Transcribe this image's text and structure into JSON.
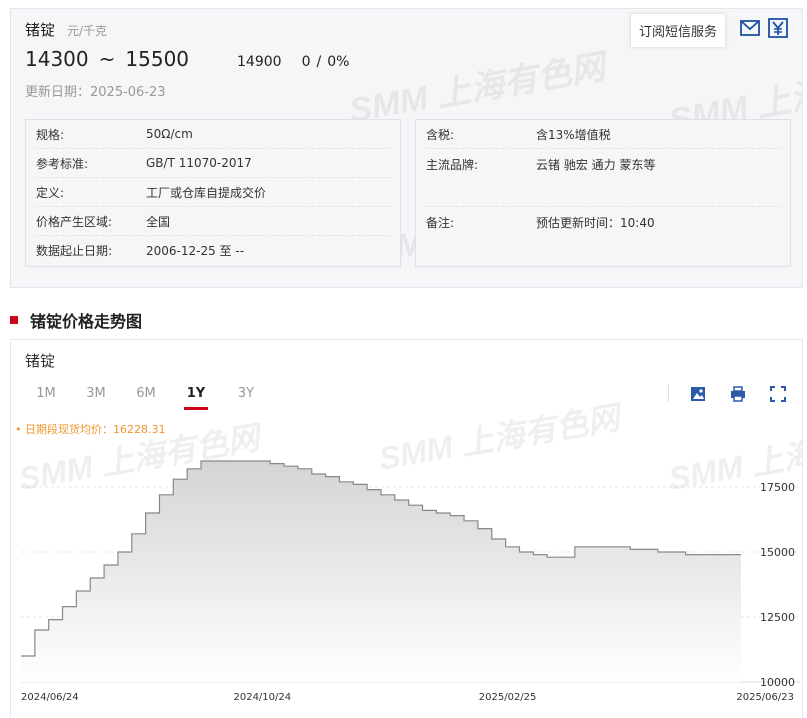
{
  "header": {
    "product": "锗锭",
    "unit": "元/千克",
    "price_low": "14300",
    "tilde": "~",
    "price_high": "15500",
    "avg": "14900",
    "change": "0",
    "change_sep": "/",
    "change_pct": "0%",
    "update_date": "更新日期：2025-06-23",
    "subscribe_label": "订阅短信服务",
    "watermark": "SMM 上海有色网",
    "icons": [
      "mail-icon",
      "yen-icon"
    ]
  },
  "info_left": [
    {
      "k": "规格:",
      "v": "50Ω/cm"
    },
    {
      "k": "参考标准:",
      "v": "GB/T 11070-2017"
    },
    {
      "k": "定义:",
      "v": "工厂或仓库自提成交价"
    },
    {
      "k": "价格产生区域:",
      "v": "全国"
    },
    {
      "k": "数据起止日期:",
      "v": "2006-12-25 至 --"
    }
  ],
  "info_right": [
    {
      "k": "含税:",
      "v": "含13%增值税"
    },
    {
      "k": "主流品牌:",
      "v": "云锗 驰宏 通力 蒙东等"
    },
    {
      "k": "备注:",
      "v": "预估更新时间：10:40"
    }
  ],
  "section": {
    "title": "锗锭价格走势图"
  },
  "chart_panel": {
    "title": "锗锭",
    "tabs": [
      "1M",
      "3M",
      "6M",
      "1Y",
      "3Y"
    ],
    "active_tab": "1Y",
    "legend": "• 日期段现货均价：16228.31",
    "tools": [
      "download-image-icon",
      "print-icon",
      "fullscreen-icon"
    ]
  },
  "colors": {
    "accent": "#d0021b",
    "legend": "#f0962d",
    "line": "#888888"
  },
  "chart_data": {
    "type": "area",
    "x": [
      "2024-06-24",
      "2024-07-01",
      "2024-07-08",
      "2024-07-15",
      "2024-07-22",
      "2024-07-29",
      "2024-08-05",
      "2024-08-12",
      "2024-08-19",
      "2024-08-26",
      "2024-09-02",
      "2024-09-09",
      "2024-09-16",
      "2024-09-23",
      "2024-09-30",
      "2024-10-07",
      "2024-10-14",
      "2024-10-21",
      "2024-10-28",
      "2024-11-04",
      "2024-11-11",
      "2024-11-18",
      "2024-11-25",
      "2024-12-02",
      "2024-12-09",
      "2024-12-16",
      "2024-12-23",
      "2024-12-30",
      "2025-01-06",
      "2025-01-13",
      "2025-01-20",
      "2025-01-27",
      "2025-02-03",
      "2025-02-10",
      "2025-02-17",
      "2025-02-24",
      "2025-03-03",
      "2025-03-10",
      "2025-03-17",
      "2025-03-24",
      "2025-03-31",
      "2025-04-07",
      "2025-04-14",
      "2025-04-21",
      "2025-04-28",
      "2025-05-05",
      "2025-05-12",
      "2025-05-19",
      "2025-05-26",
      "2025-06-02",
      "2025-06-09",
      "2025-06-16",
      "2025-06-23"
    ],
    "y": [
      11000,
      12000,
      12400,
      12900,
      13500,
      14000,
      14500,
      15000,
      15700,
      16500,
      17200,
      17800,
      18200,
      18500,
      18500,
      18500,
      18500,
      18500,
      18400,
      18300,
      18200,
      18000,
      17900,
      17700,
      17600,
      17400,
      17200,
      17000,
      16800,
      16600,
      16500,
      16400,
      16200,
      15900,
      15500,
      15200,
      15000,
      14900,
      14800,
      14800,
      15200,
      15200,
      15200,
      15200,
      15100,
      15100,
      15000,
      15000,
      14900,
      14900,
      14900,
      14900,
      14900
    ],
    "xticks": [
      "2024/06/24",
      "2024/10/24",
      "2025/02/25",
      "2025/06/23"
    ],
    "yticks": [
      "10000",
      "12500",
      "15000",
      "17500"
    ],
    "ylim": [
      10000,
      19000
    ],
    "grid": true,
    "y_axis_side": "right"
  }
}
